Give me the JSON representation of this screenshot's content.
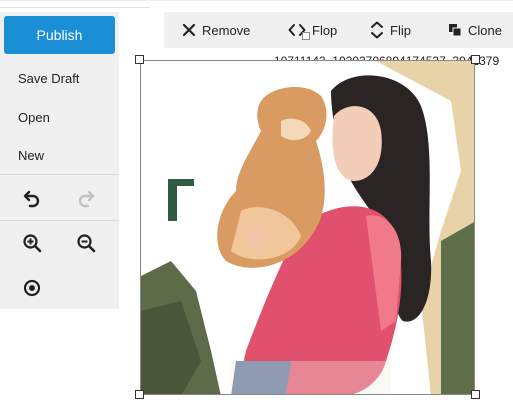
{
  "sidebar": {
    "publish_label": "Publish",
    "items": [
      {
        "label": "Save Draft"
      },
      {
        "label": "Open"
      },
      {
        "label": "New"
      }
    ],
    "icons": {
      "undo": "undo-icon",
      "redo": "redo-icon",
      "zoom_in": "zoom-in-icon",
      "zoom_out": "zoom-out-icon",
      "target": "center-target-icon"
    }
  },
  "toolbar": {
    "remove_label": "Remove",
    "flop_label": "Flop",
    "flip_label": "Flip",
    "clone_label": "Clone"
  },
  "canvas": {
    "filename": "10711142_10202706894174537_3942379"
  },
  "colors": {
    "accent": "#1a8fd6",
    "panel": "#f0f0f0"
  }
}
